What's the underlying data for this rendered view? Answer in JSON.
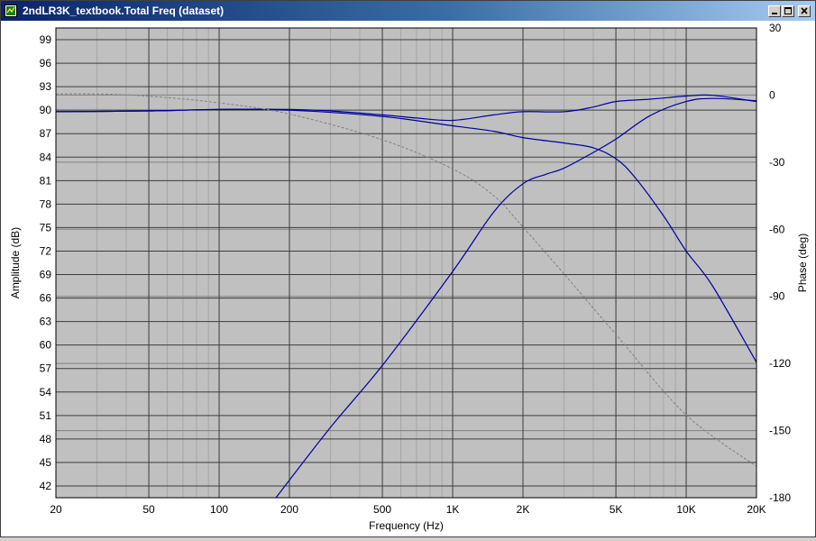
{
  "window": {
    "title": "2ndLR3K_textbook.Total Freq (dataset)",
    "icons": [
      "app-chart-icon",
      "minimize-icon",
      "maximize-icon",
      "close-icon"
    ],
    "titlebar_color": "#0a246a"
  },
  "chart_data": {
    "type": "line",
    "xlabel": "Frequency (Hz)",
    "ylabel": "Amplitude (dB)",
    "y2label": "Phase (deg)",
    "x_scale": "log",
    "xlim": [
      20,
      20000
    ],
    "ylim": [
      40.5,
      100.5
    ],
    "y2lim": [
      -180,
      30
    ],
    "grid": true,
    "background": "#c0c0c0",
    "x_ticks": [
      {
        "value": 20,
        "label": "20"
      },
      {
        "value": 50,
        "label": "50"
      },
      {
        "value": 100,
        "label": "100"
      },
      {
        "value": 200,
        "label": "200"
      },
      {
        "value": 500,
        "label": "500"
      },
      {
        "value": 1000,
        "label": "1K"
      },
      {
        "value": 2000,
        "label": "2K"
      },
      {
        "value": 5000,
        "label": "5K"
      },
      {
        "value": 10000,
        "label": "10K"
      },
      {
        "value": 20000,
        "label": "20K"
      }
    ],
    "y_ticks": [
      99,
      96,
      93,
      90,
      87,
      84,
      81,
      78,
      75,
      72,
      69,
      66,
      63,
      60,
      57,
      54,
      51,
      48,
      45,
      42
    ],
    "y2_ticks": [
      30,
      0,
      -30,
      -60,
      -90,
      -120,
      -150,
      -180
    ],
    "series": [
      {
        "axis": "left",
        "color": "#0000a0",
        "style": "solid",
        "x": [
          20,
          50,
          100,
          200,
          300,
          500,
          700,
          1000,
          1500,
          2000,
          3000,
          4000,
          5000,
          7000,
          10000,
          13000,
          20000
        ],
        "y": [
          89.8,
          89.9,
          90.1,
          90.1,
          89.9,
          89.4,
          89.0,
          88.7,
          89.4,
          89.8,
          89.8,
          90.4,
          91.1,
          91.4,
          91.8,
          91.9,
          91.1
        ]
      },
      {
        "axis": "left",
        "color": "#0000a0",
        "style": "solid",
        "x": [
          20,
          50,
          100,
          200,
          500,
          1000,
          1500,
          2000,
          3000,
          4000,
          5000,
          6000,
          8000,
          10000,
          13000,
          20000
        ],
        "y": [
          89.8,
          89.9,
          90.1,
          90.0,
          89.2,
          88.0,
          87.3,
          86.5,
          85.8,
          85.2,
          83.8,
          81.5,
          76.5,
          72.0,
          67.5,
          57.8
        ]
      },
      {
        "axis": "left",
        "color": "#0000a0",
        "style": "solid",
        "x": [
          175,
          300,
          500,
          1000,
          1500,
          2000,
          2500,
          3000,
          4000,
          5000,
          7000,
          10000,
          13000,
          20000
        ],
        "y": [
          40.5,
          49.5,
          57.4,
          69.4,
          77.0,
          80.6,
          81.8,
          82.6,
          84.6,
          86.3,
          89.3,
          91.1,
          91.5,
          91.2
        ]
      },
      {
        "axis": "right",
        "color": "#808080",
        "style": "dashed",
        "x": [
          20,
          30,
          50,
          100,
          200,
          500,
          1000,
          1500,
          2000,
          3000,
          5000,
          10000,
          20000
        ],
        "y": [
          0.5,
          0.5,
          -0.5,
          -3.5,
          -8.5,
          -20,
          -33,
          -45,
          -59,
          -80,
          -107,
          -143,
          -166
        ]
      }
    ]
  }
}
